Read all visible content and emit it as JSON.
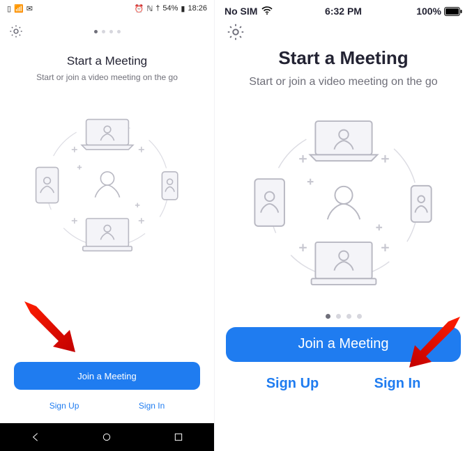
{
  "left": {
    "status": {
      "carrier_icons": "📶",
      "battery_text": "54%",
      "time": "18:26"
    },
    "title": "Start a Meeting",
    "subtitle": "Start or join a video meeting on the go",
    "join_button": "Join a Meeting",
    "sign_up": "Sign Up",
    "sign_in": "Sign In"
  },
  "right": {
    "status": {
      "carrier": "No SIM",
      "time": "6:32 PM",
      "battery": "100%"
    },
    "title": "Start a Meeting",
    "subtitle": "Start or join a video meeting on the go",
    "join_button": "Join a Meeting",
    "sign_up": "Sign Up",
    "sign_in": "Sign In"
  }
}
